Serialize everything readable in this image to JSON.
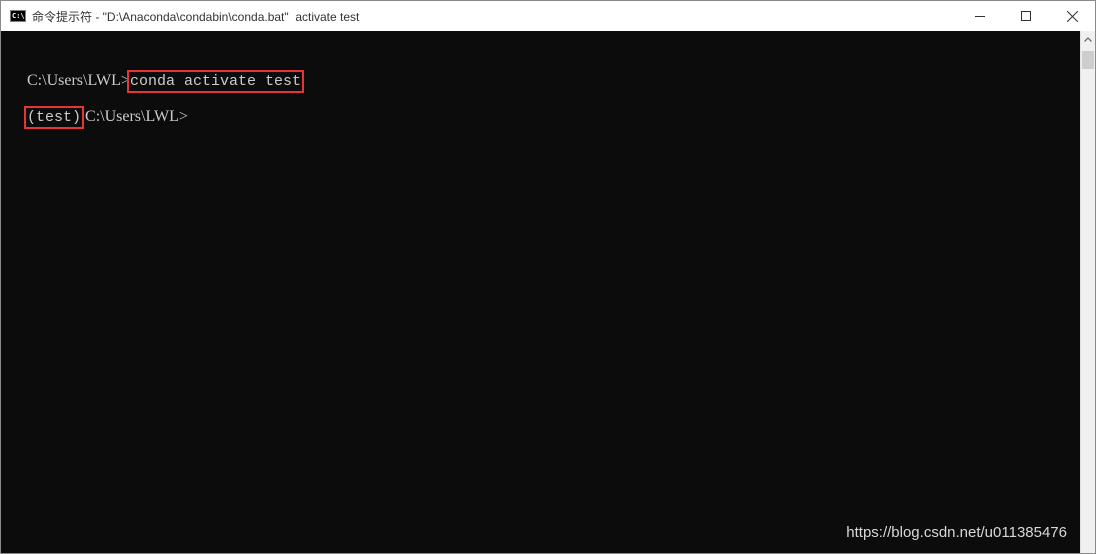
{
  "window": {
    "title": "命令提示符 - \"D:\\Anaconda\\condabin\\conda.bat\"  activate test",
    "minimize_icon": "minimize-icon",
    "maximize_icon": "maximize-icon",
    "close_icon": "close-icon"
  },
  "console": {
    "line1": {
      "prompt": "C:\\Users\\LWL>",
      "command": "conda activate test"
    },
    "line2": {
      "env": "(test)",
      "prompt": " C:\\Users\\LWL>"
    }
  },
  "watermark": "https://blog.csdn.net/u011385476",
  "colors": {
    "console_bg": "#0c0c0c",
    "console_fg": "#cccccc",
    "highlight": "#e53535"
  }
}
